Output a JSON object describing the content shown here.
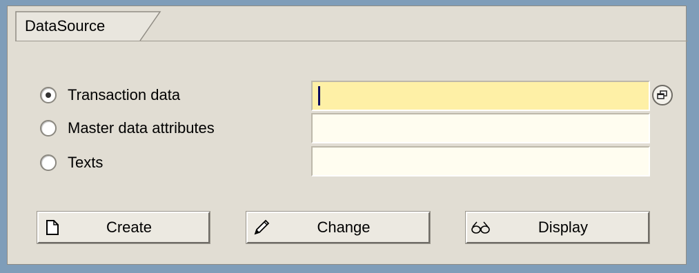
{
  "group": {
    "title": "DataSource"
  },
  "options": [
    {
      "label": "Transaction data",
      "checked": true
    },
    {
      "label": "Master data attributes",
      "checked": false
    },
    {
      "label": "Texts",
      "checked": false
    }
  ],
  "fields": [
    {
      "value": "",
      "active": true
    },
    {
      "value": "",
      "active": false
    },
    {
      "value": "",
      "active": false
    }
  ],
  "buttons": {
    "create": {
      "label": "Create",
      "icon": "document-icon"
    },
    "change": {
      "label": "Change",
      "icon": "pencil-icon"
    },
    "display": {
      "label": "Display",
      "icon": "glasses-icon"
    }
  },
  "colors": {
    "active_field": "#fef0a6",
    "inactive_field": "#fffdf0",
    "panel": "#e1ddd3",
    "outer": "#7f9db9"
  }
}
